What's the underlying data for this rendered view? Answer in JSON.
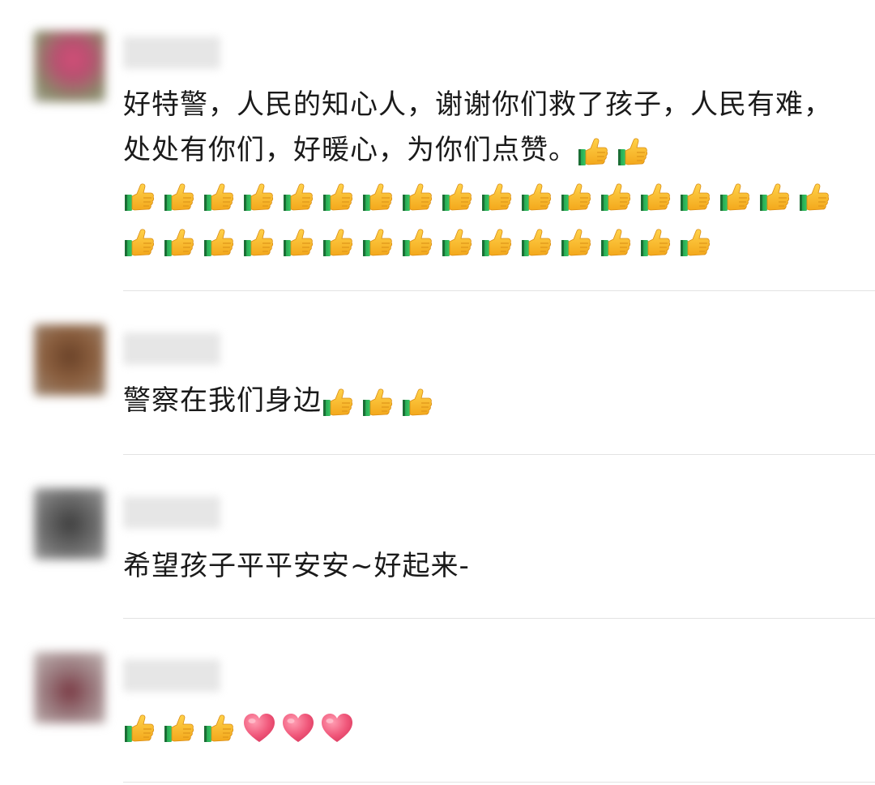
{
  "comments": [
    {
      "avatar_color": "#c85a7a",
      "text": "好特警，人民的知心人，谢谢你们救了孩子，人民有难，处处有你们，好暖心，为你们点赞。",
      "emoji": "thumbs-up-icon",
      "emoji_count": 36
    },
    {
      "avatar_color": "#7a5238",
      "text": "警察在我们身边",
      "emoji": "thumbs-up-icon",
      "emoji_count": 3
    },
    {
      "avatar_color": "#5e5e5e",
      "text": "希望孩子平平安安~好起来-"
    },
    {
      "avatar_color": "#8a6a70",
      "text": "",
      "emoji": "thumbs-up-icon",
      "emoji_count": 3,
      "hearts": "heart-icon",
      "heart_count": 3
    }
  ]
}
